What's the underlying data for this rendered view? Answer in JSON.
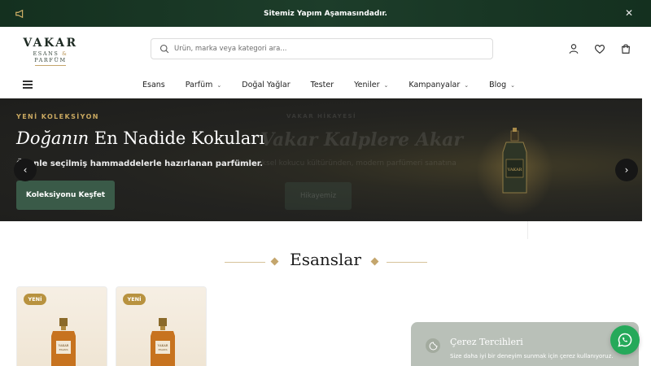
{
  "announcement": {
    "text": "Sitemiz Yapım Aşamasındadır.",
    "icon": "megaphone-icon",
    "close_icon": "close-icon"
  },
  "logo": {
    "brand": "VAKAR",
    "tag_left": "ESANS",
    "tag_amp": "&",
    "tag_right": "PARFÜM"
  },
  "search": {
    "placeholder": "Ürün, marka veya kategori ara...",
    "value": ""
  },
  "header_icons": [
    "user-icon",
    "heart-icon",
    "cart-icon"
  ],
  "nav": {
    "items": [
      {
        "label": "Esans",
        "has_dropdown": false
      },
      {
        "label": "Parfüm",
        "has_dropdown": true
      },
      {
        "label": "Doğal Yağlar",
        "has_dropdown": false
      },
      {
        "label": "Tester",
        "has_dropdown": false
      },
      {
        "label": "Yeniler",
        "has_dropdown": true
      },
      {
        "label": "Kampanyalar",
        "has_dropdown": true
      },
      {
        "label": "Blog",
        "has_dropdown": true
      }
    ]
  },
  "hero": {
    "eyebrow": "YENİ KOLEKSİYON",
    "title_em": "Doğanın",
    "title_rest": "En Nadide Kokuları",
    "subtitle": "Özenle seçilmiş hammaddelerle hazırlanan parfümler.",
    "cta": "Koleksiyonu Keşfet",
    "bottle_label": "VAKAR",
    "next_slide": {
      "eyebrow": "VAKAR HİKAYESİ",
      "title": "Vakar Kalplere Akar",
      "subtitle": "Geleneksel kokucu kültüründen, modern parfümeri sanatına",
      "cta": "Hikayemiz"
    }
  },
  "section": {
    "title": "Esanslar"
  },
  "products": [
    {
      "badge": "YENİ",
      "bottle_label_1": "VAKAR",
      "bottle_label_2": "ESANS"
    },
    {
      "badge": "YENİ",
      "bottle_label_1": "VAKAR",
      "bottle_label_2": "ESANS"
    }
  ],
  "cookie": {
    "title": "Çerez Tercihleri",
    "text": "Size daha iyi bir deneyim sunmak için çerez kullanıyoruz."
  },
  "colors": {
    "brand_green": "#1d3d2a",
    "accent_gold": "#c9a860",
    "cta_green": "#3a5a48",
    "whatsapp": "#25a95a"
  }
}
